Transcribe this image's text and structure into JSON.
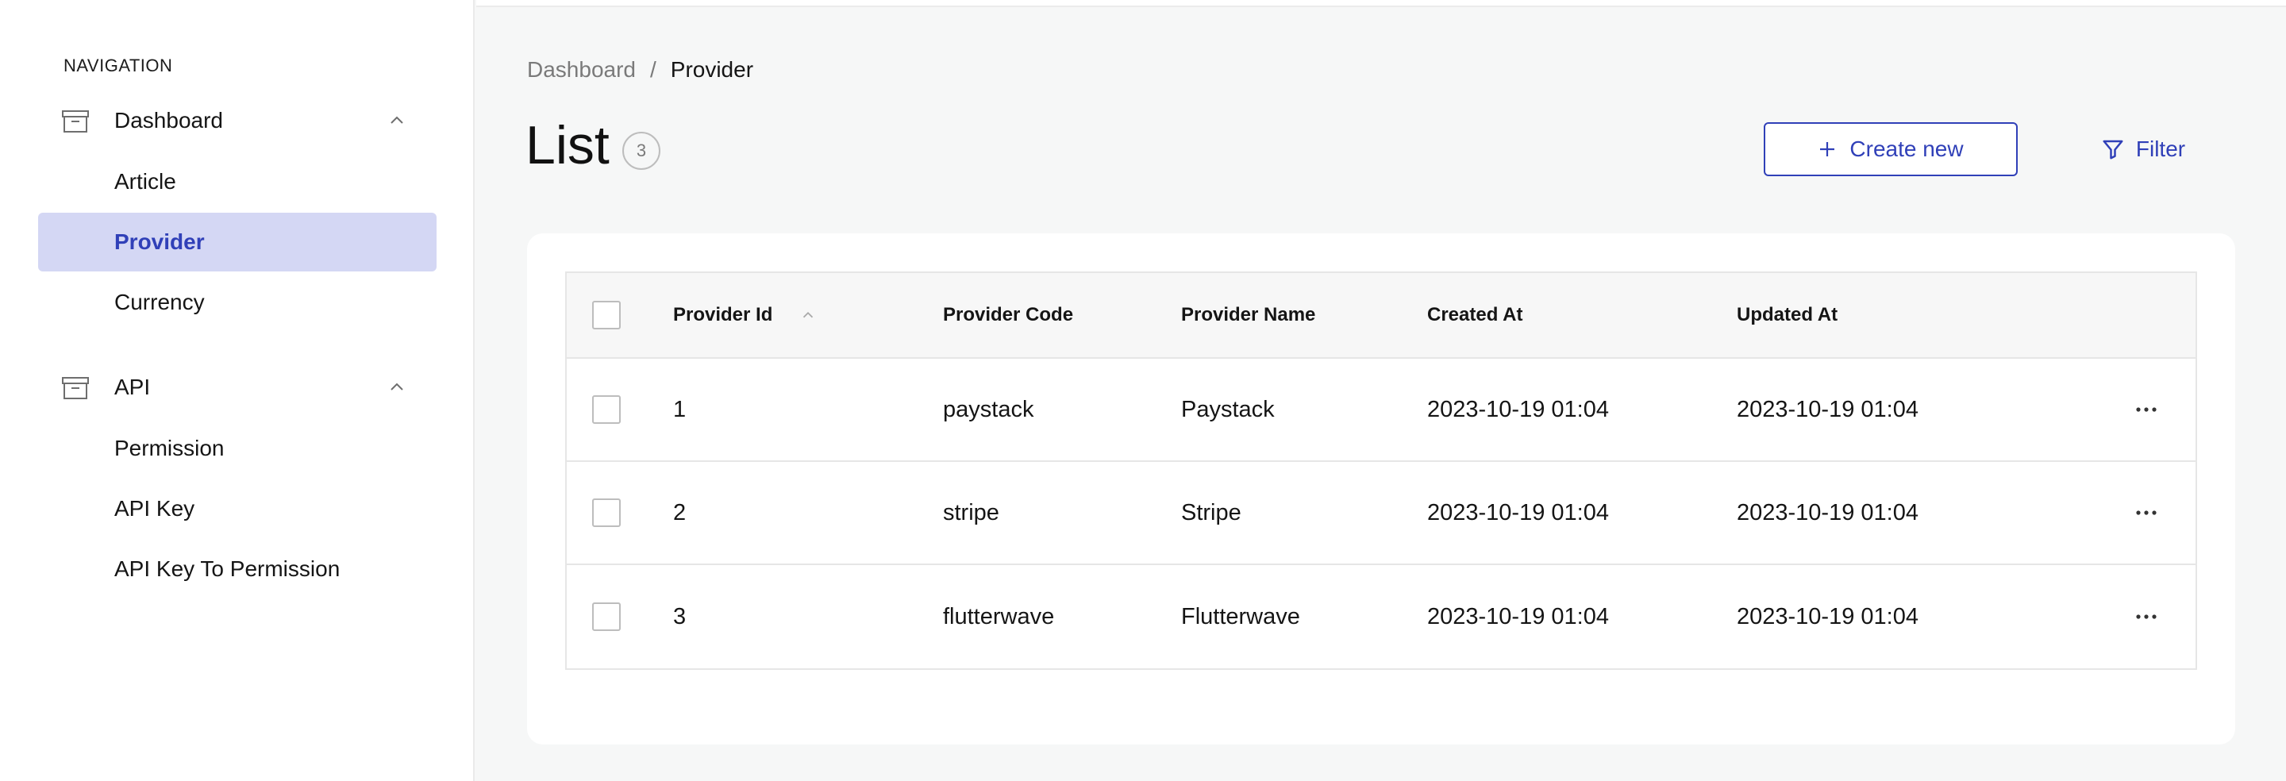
{
  "sidebar": {
    "heading": "NAVIGATION",
    "groups": [
      {
        "label": "Dashboard",
        "icon": "archive-icon",
        "expanded": true,
        "items": [
          {
            "label": "Article"
          },
          {
            "label": "Provider",
            "active": true
          },
          {
            "label": "Currency"
          }
        ]
      },
      {
        "label": "API",
        "icon": "archive-icon",
        "expanded": true,
        "items": [
          {
            "label": "Permission"
          },
          {
            "label": "API Key"
          },
          {
            "label": "API Key To Permission"
          }
        ]
      }
    ]
  },
  "breadcrumb": {
    "root": "Dashboard",
    "separator": "/",
    "current": "Provider"
  },
  "page": {
    "title": "List",
    "count": "3"
  },
  "actions": {
    "create_label": "Create new",
    "filter_label": "Filter"
  },
  "table": {
    "columns": [
      "Provider Id",
      "Provider Code",
      "Provider Name",
      "Created At",
      "Updated At"
    ],
    "sorted_column": "Provider Id",
    "rows": [
      {
        "id": "1",
        "code": "paystack",
        "name": "Paystack",
        "created": "2023-10-19 01:04",
        "updated": "2023-10-19 01:04"
      },
      {
        "id": "2",
        "code": "stripe",
        "name": "Stripe",
        "created": "2023-10-19 01:04",
        "updated": "2023-10-19 01:04"
      },
      {
        "id": "3",
        "code": "flutterwave",
        "name": "Flutterwave",
        "created": "2023-10-19 01:04",
        "updated": "2023-10-19 01:04"
      }
    ]
  },
  "colors": {
    "accent": "#3040b8",
    "active_bg": "#d4d7f4",
    "page_bg": "#f6f7f7"
  }
}
